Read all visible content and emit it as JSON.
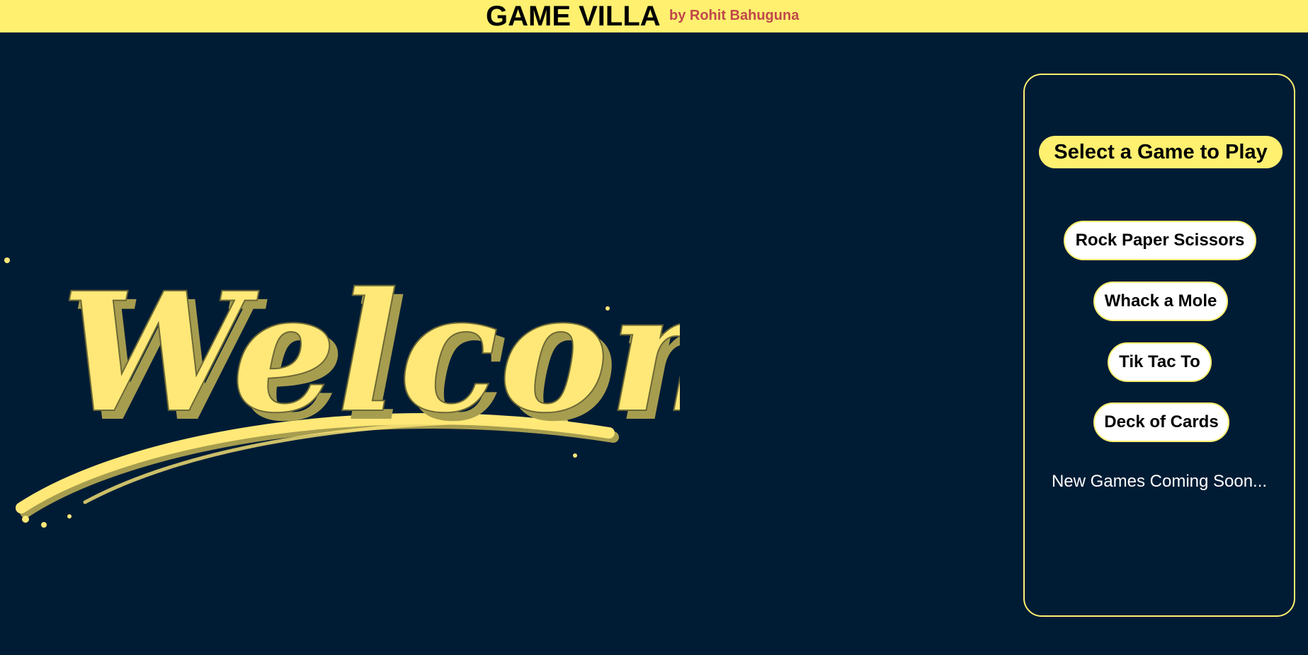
{
  "header": {
    "title": "GAME VILLA",
    "author": "by Rohit Bahuguna"
  },
  "hero": {
    "text": "Welcome"
  },
  "panel": {
    "heading": "Select a Game to Play",
    "games": [
      {
        "label": "Rock Paper Scissors"
      },
      {
        "label": "Whack a Mole"
      },
      {
        "label": "Tik Tac To"
      },
      {
        "label": "Deck of Cards"
      }
    ],
    "footer_note": "New Games Coming Soon..."
  },
  "colors": {
    "background": "#001c35",
    "accent_yellow": "#fff06f",
    "author_red": "#c0474b",
    "button_bg": "#ffffff"
  }
}
